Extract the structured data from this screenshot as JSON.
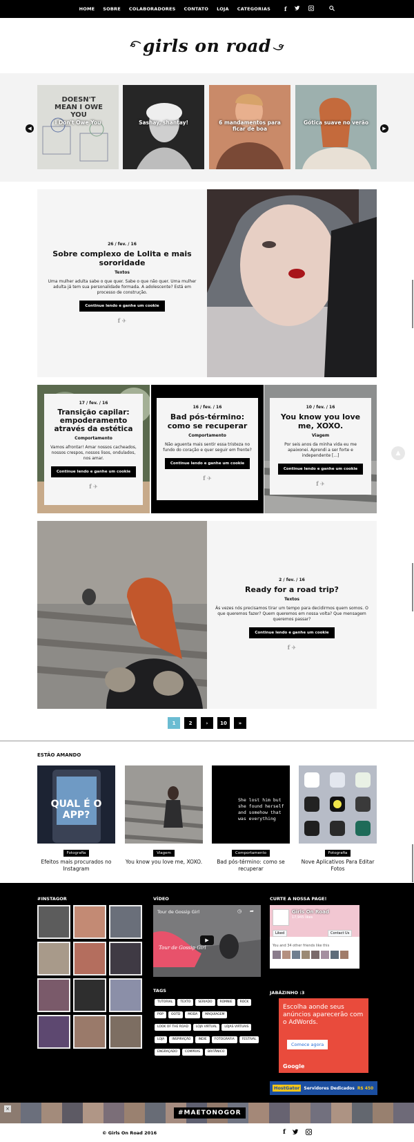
{
  "nav": {
    "items": [
      "HOME",
      "SOBRE",
      "COLABORADORES",
      "CONTATO",
      "LOJA",
      "CATEGORIAS"
    ],
    "icons": [
      "facebook-icon",
      "twitter-icon",
      "instagram-icon",
      "search-icon"
    ]
  },
  "logo": {
    "text": "girls on road"
  },
  "slider": {
    "slides": [
      {
        "title": "I Don't Owe You",
        "art": "DOESN'T MEAN I OWE YOU"
      },
      {
        "title": "Sashay, shantay!"
      },
      {
        "title": "6 mandamentos para ficar de boa"
      },
      {
        "title": "Gótica suave no verão"
      }
    ]
  },
  "posts": {
    "p1": {
      "date": "26 / fev. / 16",
      "title": "Sobre complexo de Lolita e mais sororidade",
      "category": "Textos",
      "excerpt": "Uma mulher adulta sabe o que quer. Sabe o que não quer. Uma mulher adulta já tem sua personalidade formada. A adolescente? Está em processo de construção.",
      "button": "Continue lendo e ganhe um cookie"
    },
    "p2": {
      "date": "17 / fev. / 16",
      "title": "Transição capilar: empoderamento através da estética",
      "category": "Comportamento",
      "excerpt": "Vamos afrontar! Amar nossos cacheados, nossos crespos, nossos lisos, ondulados, nos amar.",
      "button": "Continue lendo e ganhe um cookie"
    },
    "p3": {
      "date": "16 / fev. / 16",
      "title": "Bad pós-término: como se recuperar",
      "category": "Comportamento",
      "excerpt": "Não aguenta mais sentir essa tristeza no fundo do coração e quer seguir em frente?",
      "button": "Continue lendo e ganhe um cookie"
    },
    "p4": {
      "date": "10 / fev. / 16",
      "title": "You know you love me, XOXO.",
      "category": "Viagem",
      "excerpt": "Por seis anos da minha vida eu me apaixonei. Aprendi a ser forte e independente [...]",
      "button": "Continue lendo e ganhe um cookie"
    },
    "p5": {
      "date": "2 / fev. / 16",
      "title": "Ready for a road trip?",
      "category": "Textos",
      "excerpt": "Às vezes nós precisamos tirar um tempo para decidirmos quem somos. O que queremos fazer? Quem queremos em nossa volta? Que mensagem queremos passar?",
      "button": "Continue lendo e ganhe um cookie"
    }
  },
  "pager": {
    "pages": [
      "1",
      "2",
      "›",
      "10",
      "»"
    ]
  },
  "amando": {
    "heading": "ESTÃO AMANDO",
    "items": [
      {
        "tag": "Fotografia",
        "title": "Efeitos mais procurados no Instagram",
        "art": "QUAL É O APP?"
      },
      {
        "tag": "Viagem",
        "title": "You know you love me, XOXO."
      },
      {
        "tag": "Comportamento",
        "title": "Bad pós-término: como se recuperar",
        "art": "She lost him but she found herself and somehow that was everything"
      },
      {
        "tag": "Fotografia",
        "title": "Nove Aplicativos Para Editar Fotos"
      }
    ]
  },
  "footer": {
    "instagram_heading": "#INSTAGOR",
    "video_heading": "VÍDEO",
    "video_title": "Tour de Gossip Girl",
    "video_overlay": "Tour de Gossip Girl",
    "page_heading": "CURTE A NOSSA PAGE!",
    "fb_name": "Girls On Road",
    "fb_likes": "17,945 likes",
    "fb_liked": "Liked",
    "fb_contact": "Contact Us",
    "fb_friends": "You and 34 other friends like this",
    "tags_heading": "TAGS",
    "tags": [
      "TUTORIAL",
      "TEXTO",
      "SERIADO",
      "ROMNIE",
      "ROCK",
      "POP",
      "OOTD",
      "MODA",
      "MAQUIAGEM",
      "LOOK OF THE ROAD",
      "LOJA VIRTUAL",
      "LOJAS VIRTUAIS",
      "LOJA",
      "INSPIRAÇÃO",
      "INDIE",
      "FOTOGRAFIA",
      "FESTIVAL",
      "ENGRAÇADO",
      "COMPRAS",
      "BRITÂNICO"
    ],
    "ads_heading": "JABÁZINHO :3",
    "ad_text": "Escolha aonde seus anúncios aparecerão com o AdWords.",
    "ad_button": "Comece agora",
    "ad_brand": "Google",
    "banner_brand": "HostGator",
    "banner_text": "Servidores Dedicados",
    "banner_price": "R$ 450",
    "hashtag": "#MAETONOGOR",
    "copyright": "© Girls On Road 2016"
  },
  "colors": {
    "accent": "#6bbcd2",
    "adRed": "#e94b3c"
  }
}
